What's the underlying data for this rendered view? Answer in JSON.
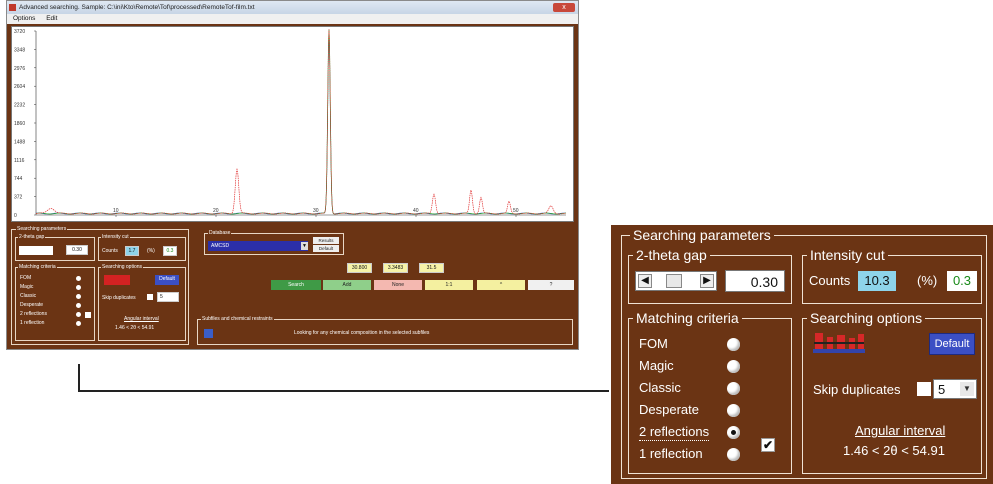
{
  "window": {
    "title": "Advanced searching.  Sample: C:\\ini\\Kto\\Remote\\Tof\\processed\\RemoteTof-film.txt",
    "close_label": "x"
  },
  "menu": [
    "Options",
    "Edit"
  ],
  "plot": {
    "y_ticks": [
      "3720",
      "3348",
      "2976",
      "2604",
      "2232",
      "1860",
      "1488",
      "1116",
      "744",
      "372",
      "0"
    ],
    "x_ticks": [
      "10",
      "20",
      "30",
      "40",
      "50"
    ],
    "colors": {
      "red": "#e03030",
      "green": "#2aa02a",
      "blue": "#3050d0"
    }
  },
  "search_params": {
    "title": "Searching parameters",
    "theta_gap": {
      "title": "2-theta gap",
      "value": "0.30"
    },
    "intensity_cut": {
      "title": "Intensity cut",
      "counts_label": "Counts",
      "counts_value": "10.3",
      "percent_label": "(%)",
      "percent_value": "0.3"
    },
    "matching": {
      "title": "Matching criteria",
      "items": [
        {
          "label": "FOM",
          "selected": false
        },
        {
          "label": "Magic",
          "selected": false
        },
        {
          "label": "Classic",
          "selected": false
        },
        {
          "label": "Desperate",
          "selected": false
        },
        {
          "label": "2 reflections",
          "selected": true
        },
        {
          "label": "1 reflection",
          "selected": false
        }
      ],
      "check": "✔"
    },
    "search_options": {
      "title": "Searching options",
      "default_label": "Default",
      "skip_label": "Skip duplicates",
      "skip_value": "5",
      "angular_label": "Angular interval",
      "angular_value": "1.46  < 2θ <    54.91"
    }
  },
  "small_panel": {
    "counts_value": "1.7",
    "angular_value": "1.46  < 2θ <   54.91"
  },
  "database": {
    "title": "Database",
    "selected": "AMCSD",
    "btn1": "Results",
    "btn2": "Default"
  },
  "numbers": [
    "30.800",
    "3.3483",
    "31.5"
  ],
  "buttons": [
    {
      "label": "Search",
      "color": "#3f9a46"
    },
    {
      "label": "Add",
      "color": "#8fcf8a"
    },
    {
      "label": "None",
      "color": "#f4b8b0"
    },
    {
      "label": "1:1",
      "color": "#f4f0a0"
    },
    {
      "label": "^",
      "color": "#f4f0a0"
    },
    {
      "label": "?",
      "color": "#f0f0f0"
    }
  ],
  "subfiles": {
    "title": "Subfiles and chemical restraints",
    "message": "Looking for any chemical composition  in the selected subfiles"
  }
}
